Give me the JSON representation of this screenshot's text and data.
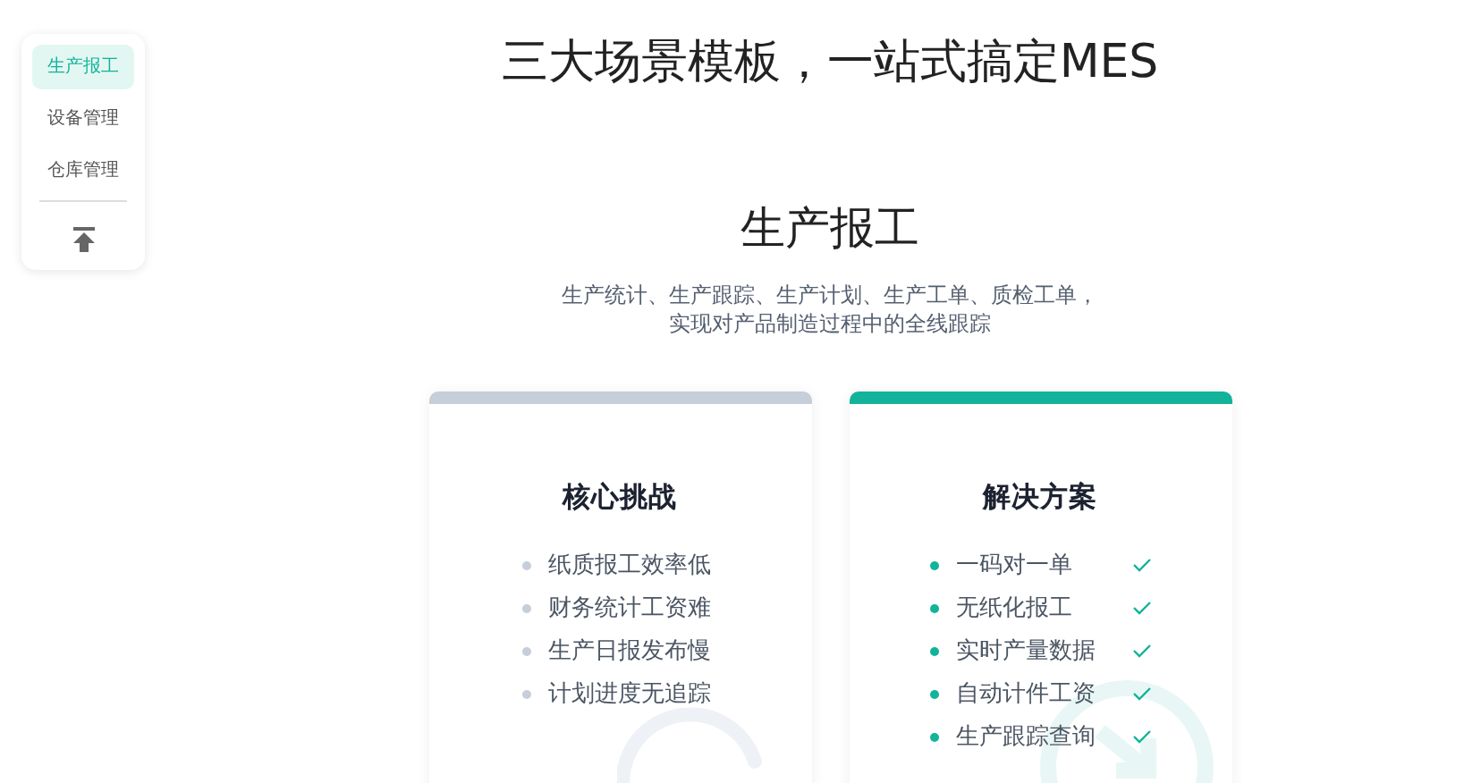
{
  "sidebar": {
    "items": [
      {
        "label": "生产报工",
        "selected": true
      },
      {
        "label": "设备管理",
        "selected": false
      },
      {
        "label": "仓库管理",
        "selected": false
      }
    ]
  },
  "heading": "三大场景模板，一站式搞定MES",
  "section": {
    "title": "生产报工",
    "description": [
      "生产统计、生产跟踪、生产计划、生产工单、质检工单，",
      "实现对产品制造过程中的全线跟踪"
    ],
    "cards": [
      {
        "kind": "challenge",
        "title": "核心挑战",
        "items": [
          "纸质报工效率低",
          "财务统计工资难",
          "生产日报发布慢",
          "计划进度无追踪"
        ]
      },
      {
        "kind": "solution",
        "title": "解决方案",
        "items": [
          "一码对一单",
          "无纸化报工",
          "实时产量数据",
          "自动计件工资",
          "生产跟踪查询"
        ]
      }
    ]
  }
}
